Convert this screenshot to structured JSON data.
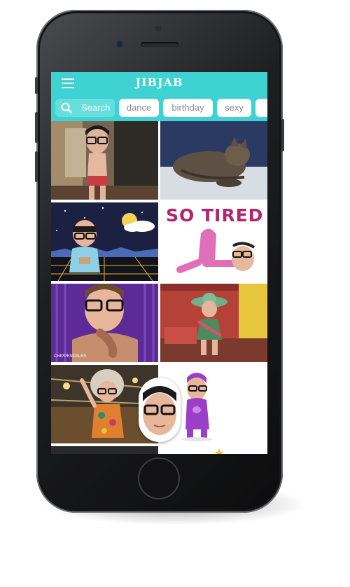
{
  "app": {
    "logo": "JIBJAB"
  },
  "search": {
    "label": "Search"
  },
  "chips": [
    {
      "label": "dance"
    },
    {
      "label": "birthday"
    },
    {
      "label": "sexy"
    }
  ],
  "tiles": [
    {
      "name": "dancer-boxers-tile"
    },
    {
      "name": "kitten-stretch-tile"
    },
    {
      "name": "night-city-dance-tile"
    },
    {
      "name": "so-tired-tile",
      "text": "SO TIRED"
    },
    {
      "name": "chippendales-tile",
      "text": "CHIPPENDALES"
    },
    {
      "name": "sombrero-dance-tile"
    },
    {
      "name": "disco-dancer-tile"
    },
    {
      "name": "purple-character-tile"
    }
  ],
  "colors": {
    "accent": "#3fd2d2",
    "search_pill": "#66dede",
    "chip_text": "#8c8c8c",
    "so_tired_text": "#b0276d"
  }
}
